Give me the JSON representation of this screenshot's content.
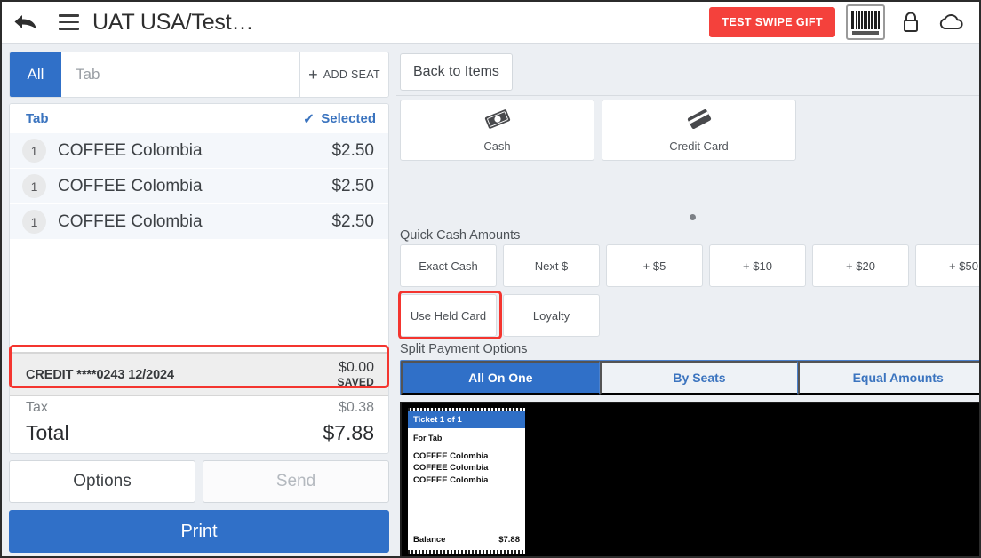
{
  "header": {
    "back_icon": "back-arrow-icon",
    "menu_icon": "hamburger-menu-icon",
    "title": "UAT USA/Test…",
    "swipe_gift_label": "TEST SWIPE GIFT",
    "barcode_icon": "barcode-scanner-icon",
    "lock_icon": "lock-icon",
    "cloud_icon": "cloud-icon"
  },
  "left_panel": {
    "seat_bar": {
      "all_label": "All",
      "tab_placeholder": "Tab",
      "add_seat_label": "ADD SEAT",
      "add_seat_icon": "plus-icon"
    },
    "ticket": {
      "tab_label": "Tab",
      "selected_label": "Selected",
      "selected_icon": "checkmark-icon",
      "items": [
        {
          "qty": "1",
          "name": "COFFEE Colombia",
          "price": "$2.50"
        },
        {
          "qty": "1",
          "name": "COFFEE Colombia",
          "price": "$2.50"
        },
        {
          "qty": "1",
          "name": "COFFEE Colombia",
          "price": "$2.50"
        }
      ]
    },
    "totals": {
      "payment_label": "CREDIT ****0243 12/2024",
      "payment_amount": "$0.00",
      "payment_status": "SAVED",
      "tax_label": "Tax",
      "tax_value": "$0.38",
      "total_label": "Total",
      "total_value": "$7.88"
    },
    "actions": {
      "options_label": "Options",
      "send_label": "Send",
      "print_label": "Print"
    }
  },
  "right_panel": {
    "back_to_items_label": "Back to Items",
    "payment_methods": [
      {
        "label": "Cash",
        "icon": "cash-bill-icon"
      },
      {
        "label": "Credit Card",
        "icon": "credit-card-icon"
      }
    ],
    "quick_cash_label": "Quick Cash Amounts",
    "quick_cash_buttons": [
      "Exact Cash",
      "Next $",
      "+ $5",
      "+ $10",
      "+ $20",
      "+ $50"
    ],
    "held_buttons": [
      "Use Held Card",
      "Loyalty"
    ],
    "split_label": "Split Payment Options",
    "split_options": [
      {
        "label": "All On One",
        "active": true
      },
      {
        "label": "By Seats",
        "active": false
      },
      {
        "label": "Equal Amounts",
        "active": false
      }
    ]
  },
  "receipt": {
    "ticket_title": "Ticket 1 of 1",
    "for_label": "For Tab",
    "items": [
      "COFFEE Colombia",
      "COFFEE Colombia",
      "COFFEE Colombia"
    ],
    "balance_label": "Balance",
    "balance_value": "$7.88"
  },
  "annotations": {
    "payment_highlight": "credit-payment-row-highlight",
    "held_card_highlight": "use-held-card-highlight",
    "color": "#f4352f"
  },
  "colors": {
    "accent_blue": "#3070c8",
    "link_blue": "#3b74bf",
    "danger_red": "#f4413c",
    "annotation_red": "#f4352f",
    "page_bg": "#eceff3"
  }
}
